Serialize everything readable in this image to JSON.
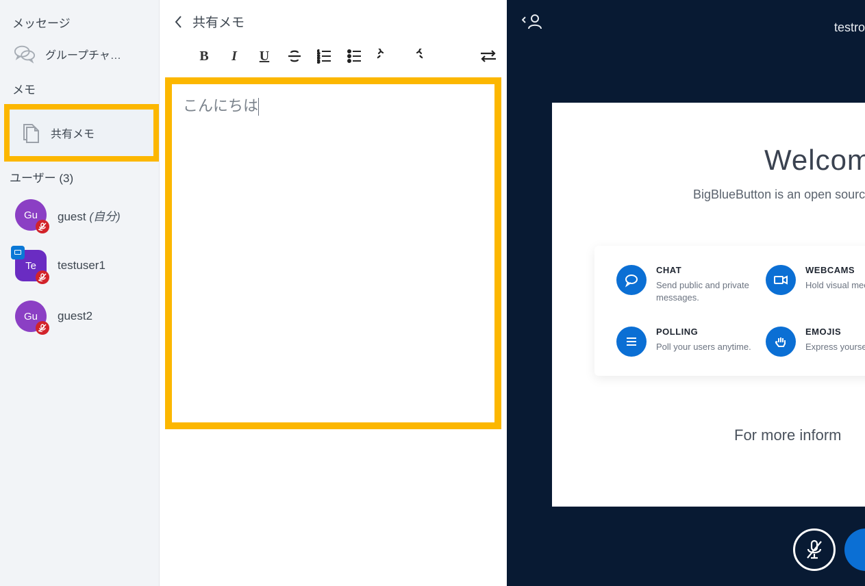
{
  "sidebar": {
    "messages_title": "メッセージ",
    "group_chat_label": "グループチャ…",
    "memo_title": "メモ",
    "shared_memo_label": "共有メモ",
    "users_title": "ユーザー (3)",
    "users": [
      {
        "initials": "Gu",
        "name": "guest",
        "self_tag": "(自分)",
        "color": "#8b3fc4",
        "muted": true,
        "square": false,
        "presenter": false
      },
      {
        "initials": "Te",
        "name": "testuser1",
        "self_tag": "",
        "color": "#6a2cc2",
        "muted": true,
        "square": true,
        "presenter": true
      },
      {
        "initials": "Gu",
        "name": "guest2",
        "self_tag": "",
        "color": "#8b3fc4",
        "muted": true,
        "square": false,
        "presenter": false
      }
    ]
  },
  "notes": {
    "header": "共有メモ",
    "content": "こんにちは"
  },
  "stage": {
    "room_label": "testro",
    "welcome_heading": "Welcome",
    "welcome_sub": "BigBlueButton is an open source w",
    "features": [
      {
        "title": "CHAT",
        "desc": "Send public and private messages.",
        "icon": "chat"
      },
      {
        "title": "WEBCAMS",
        "desc": "Hold visual mee",
        "icon": "webcam"
      },
      {
        "title": "POLLING",
        "desc": "Poll your users anytime.",
        "icon": "polling"
      },
      {
        "title": "EMOJIS",
        "desc": "Express yourse",
        "icon": "emoji"
      }
    ],
    "more_info": "For more inform"
  }
}
